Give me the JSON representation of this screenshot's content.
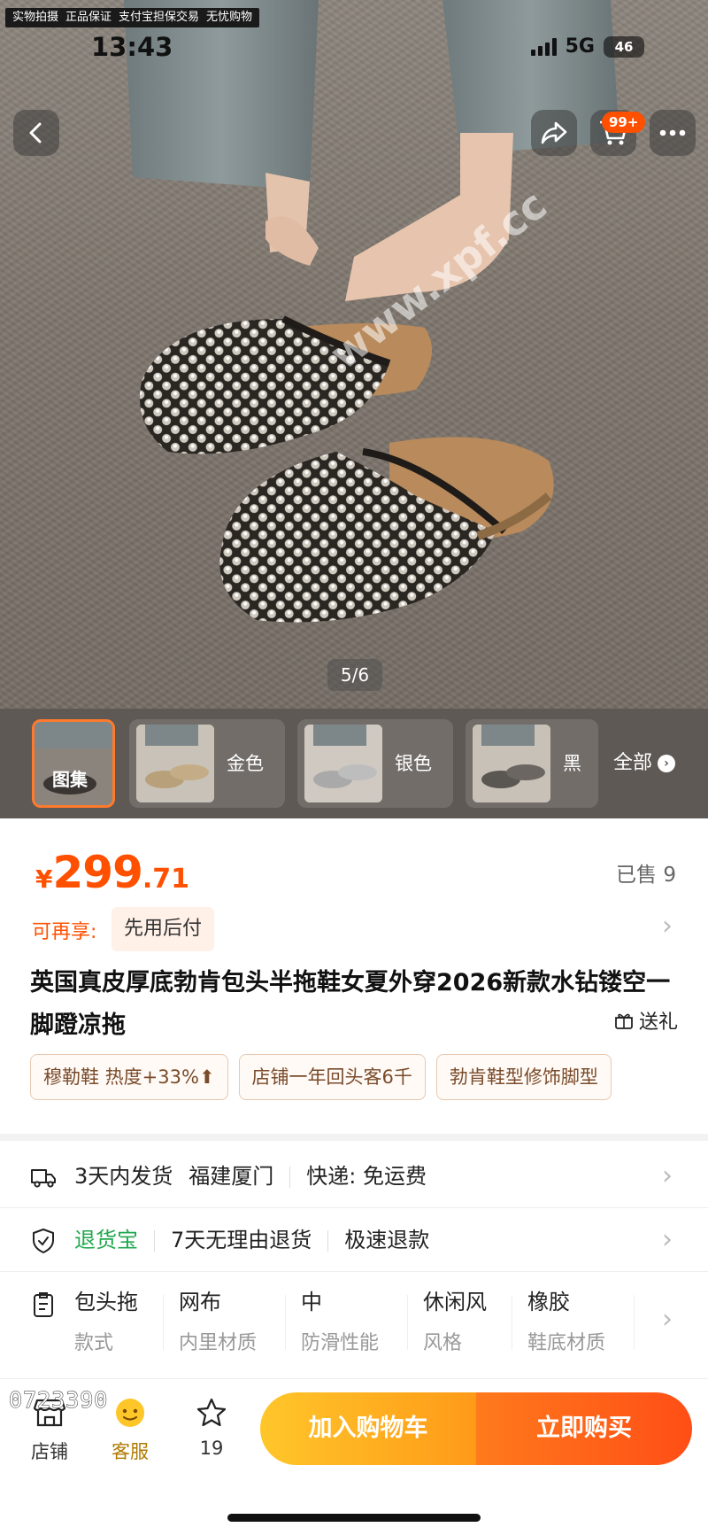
{
  "status_bar": {
    "time": "13:43",
    "network": "5G",
    "battery": "46"
  },
  "banner": [
    "实物拍摄",
    "正品保证",
    "支付宝担保交易",
    "无忧购物"
  ],
  "header": {
    "cart_badge": "99+"
  },
  "watermark": "www.xpf.cc",
  "gallery": {
    "counter": "5/6",
    "thumbs": [
      {
        "label": "图集"
      },
      {
        "label": "金色"
      },
      {
        "label": "银色"
      },
      {
        "label": "黑色"
      }
    ],
    "all_label": "全部"
  },
  "product": {
    "currency": "¥",
    "price_int": "299",
    "price_dec": ".71",
    "sold": "已售 9",
    "credit_label": "可再享:",
    "credit_chip": "先用后付",
    "title": "英国真皮厚底勃肯包头半拖鞋女夏外穿2026新款水钻镂空一脚蹬凉拖",
    "gift": "送礼",
    "tags": [
      "穆勒鞋 热度+33%⬆",
      "店铺一年回头客6千",
      "勃肯鞋型修饰脚型"
    ]
  },
  "details": {
    "shipping": [
      "3天内发货",
      "福建厦门",
      "快递: 免运费"
    ],
    "returns_brand": "退货宝",
    "returns": [
      "7天无理由退货",
      "极速退款"
    ],
    "attributes": [
      {
        "value": "包头拖",
        "key": "款式"
      },
      {
        "value": "网布",
        "key": "内里材质"
      },
      {
        "value": "中",
        "key": "防滑性能"
      },
      {
        "value": "休闲风",
        "key": "风格"
      },
      {
        "value": "橡胶",
        "key": "鞋底材质"
      }
    ]
  },
  "bottom_bar": {
    "shop": "店铺",
    "service": "客服",
    "favorites": "19",
    "add_to_cart": "加入购物车",
    "buy_now": "立即购买"
  },
  "image_code": "0723390",
  "colors": {
    "accent": "#ff5000",
    "cart_cta": "#ffb020",
    "buy_cta": "#ff5a1a",
    "returns_green": "#20a84e"
  }
}
